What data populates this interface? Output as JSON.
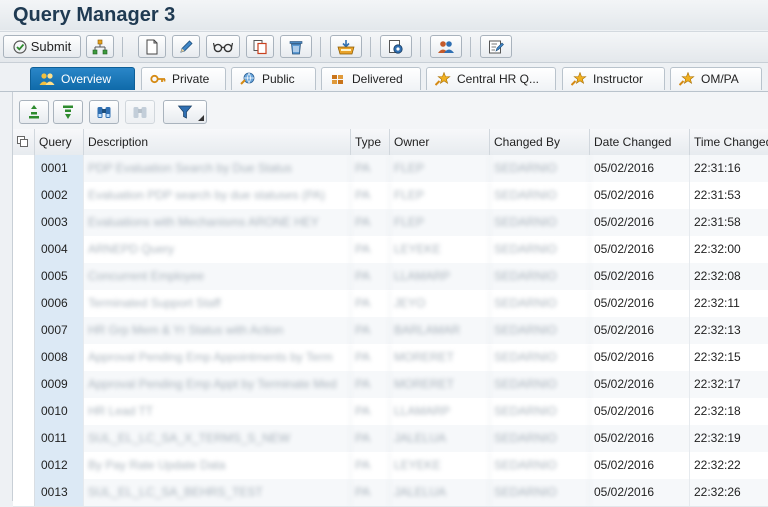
{
  "window": {
    "title": "Query Manager 3"
  },
  "toolbar": {
    "submit_label": "Submit"
  },
  "tabs": [
    {
      "label": "Overview",
      "active": true
    },
    {
      "label": "Private",
      "active": false
    },
    {
      "label": "Public",
      "active": false
    },
    {
      "label": "Delivered",
      "active": false
    },
    {
      "label": "Central HR Q...",
      "active": false
    },
    {
      "label": "Instructor",
      "active": false
    },
    {
      "label": "OM/PA",
      "active": false
    }
  ],
  "grid": {
    "columns": [
      "Query",
      "Description",
      "Type",
      "Owner",
      "Changed By",
      "Date Changed",
      "Time Changed"
    ],
    "rows": [
      {
        "query": "0001",
        "description": "PDP Evaluation Search by Due Status",
        "type": "PA",
        "owner": "FLEP",
        "changed_by": "SEDARNIO",
        "date": "05/02/2016",
        "time": "22:31:16"
      },
      {
        "query": "0002",
        "description": "Evaluation PDP search by due statuses (PA)",
        "type": "PA",
        "owner": "FLEP",
        "changed_by": "SEDARNIO",
        "date": "05/02/2016",
        "time": "22:31:53"
      },
      {
        "query": "0003",
        "description": "Evaluations with Mechanisms ARONE HEY",
        "type": "PA",
        "owner": "FLEP",
        "changed_by": "SEDARNIO",
        "date": "05/02/2016",
        "time": "22:31:58"
      },
      {
        "query": "0004",
        "description": "ARNEPD Query",
        "type": "PA",
        "owner": "LEYEKE",
        "changed_by": "SEDARNIO",
        "date": "05/02/2016",
        "time": "22:32:00"
      },
      {
        "query": "0005",
        "description": "Concurrent Employee",
        "type": "PA",
        "owner": "LLAMARP",
        "changed_by": "SEDARNIO",
        "date": "05/02/2016",
        "time": "22:32:08"
      },
      {
        "query": "0006",
        "description": "Terminated Support Staff",
        "type": "PA",
        "owner": "JEYO",
        "changed_by": "SEDARNIO",
        "date": "05/02/2016",
        "time": "22:32:11"
      },
      {
        "query": "0007",
        "description": "HR Grp Mem & Yr Status with Action",
        "type": "PA",
        "owner": "BARLAMAR",
        "changed_by": "SEDARNIO",
        "date": "05/02/2016",
        "time": "22:32:13"
      },
      {
        "query": "0008",
        "description": "Approval Pending Emp Appointments by Term",
        "type": "PA",
        "owner": "MORERET",
        "changed_by": "SEDARNIO",
        "date": "05/02/2016",
        "time": "22:32:15"
      },
      {
        "query": "0009",
        "description": "Approval Pending Emp Appt by Terminate Med",
        "type": "PA",
        "owner": "MORERET",
        "changed_by": "SEDARNIO",
        "date": "05/02/2016",
        "time": "22:32:17"
      },
      {
        "query": "0010",
        "description": "HR Lead TT",
        "type": "PA",
        "owner": "LLAMARP",
        "changed_by": "SEDARNIO",
        "date": "05/02/2016",
        "time": "22:32:18"
      },
      {
        "query": "0011",
        "description": "SUL_EL_LC_SA_X_TERMS_S_NEW",
        "type": "PA",
        "owner": "JALELUA",
        "changed_by": "SEDARNIO",
        "date": "05/02/2016",
        "time": "22:32:19"
      },
      {
        "query": "0012",
        "description": "By Pay Rate Update Data",
        "type": "PA",
        "owner": "LEYEKE",
        "changed_by": "SEDARNIO",
        "date": "05/02/2016",
        "time": "22:32:22"
      },
      {
        "query": "0013",
        "description": "SUL_EL_LC_SA_BEHRS_TEST",
        "type": "PA",
        "owner": "JALELUA",
        "changed_by": "SEDARNIO",
        "date": "05/02/2016",
        "time": "22:32:26"
      }
    ]
  }
}
